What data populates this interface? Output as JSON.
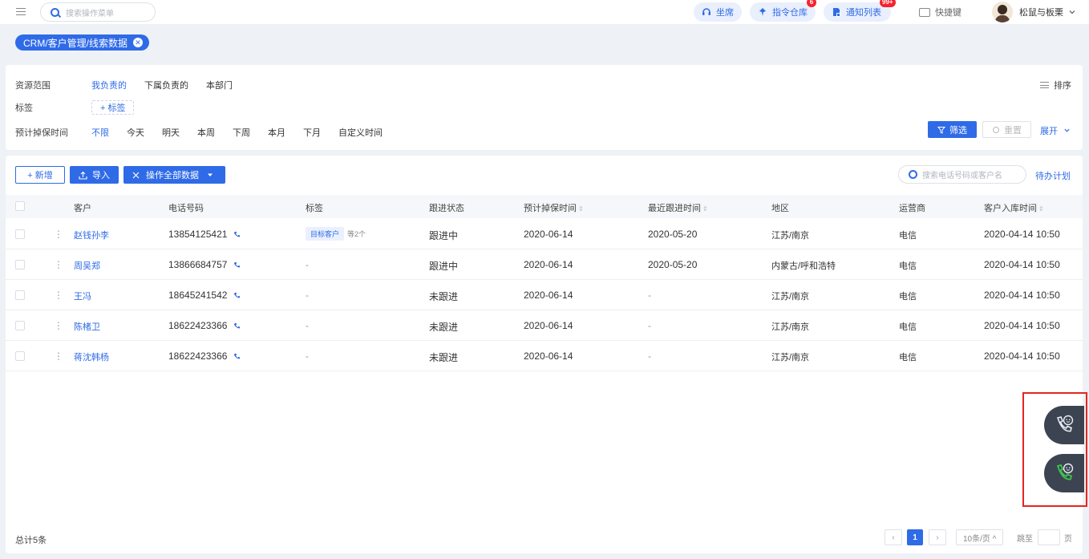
{
  "topbar": {
    "search_placeholder": "搜索操作菜单",
    "seat_label": "坐席",
    "command_label": "指令仓库",
    "command_badge": "6",
    "notify_label": "通知列表",
    "notify_badge": "99+",
    "shortcut_label": "快捷键",
    "user_name": "松鼠与板栗"
  },
  "breadcrumb": {
    "label": "CRM/客户管理/线索数据"
  },
  "filters": {
    "scope_label": "资源范围",
    "scope_options": [
      "我负责的",
      "下属负责的",
      "本部门"
    ],
    "tag_label": "标签",
    "tag_add": "+ 标签",
    "time_label": "预计掉保时间",
    "time_options": [
      "不限",
      "今天",
      "明天",
      "本周",
      "下周",
      "本月",
      "下月",
      "自定义时间"
    ],
    "sort_label": "排序",
    "filter_button": "筛选",
    "reset_button": "重置",
    "expand_label": "展开"
  },
  "toolbar": {
    "add_button": "+ 新增",
    "import_button": "导入",
    "ops_button": "操作全部数据",
    "search_placeholder": "搜索电话号码或客户名",
    "todo_link": "待办计划"
  },
  "table": {
    "headers": [
      "客户",
      "电话号码",
      "标签",
      "跟进状态",
      "预计掉保时间",
      "最近跟进时间",
      "地区",
      "运营商",
      "客户入库时间"
    ],
    "rows": [
      {
        "customer": "赵钱孙李",
        "phone": "13854125421",
        "tag": "目标客户",
        "tag_more": "等2个",
        "status": "跟进中",
        "expected": "2020-06-14",
        "last": "2020-05-20",
        "region": "江苏/南京",
        "carrier": "电信",
        "created": "2020-04-14  10:50"
      },
      {
        "customer": "周吴郑",
        "phone": "13866684757",
        "tag": "-",
        "tag_more": "",
        "status": "跟进中",
        "expected": "2020-06-14",
        "last": "2020-05-20",
        "region": "内蒙古/呼和浩特",
        "carrier": "电信",
        "created": "2020-04-14  10:50"
      },
      {
        "customer": "王冯",
        "phone": "18645241542",
        "tag": "-",
        "tag_more": "",
        "status": "未跟进",
        "expected": "2020-06-14",
        "last": "-",
        "region": "江苏/南京",
        "carrier": "电信",
        "created": "2020-04-14  10:50"
      },
      {
        "customer": "陈楮卫",
        "phone": "18622423366",
        "tag": "-",
        "tag_more": "",
        "status": "未跟进",
        "expected": "2020-06-14",
        "last": "-",
        "region": "江苏/南京",
        "carrier": "电信",
        "created": "2020-04-14  10:50"
      },
      {
        "customer": "蒋沈韩杨",
        "phone": "18622423366",
        "tag": "-",
        "tag_more": "",
        "status": "未跟进",
        "expected": "2020-06-14",
        "last": "-",
        "region": "江苏/南京",
        "carrier": "电信",
        "created": "2020-04-14  10:50"
      }
    ]
  },
  "footer": {
    "total": "总计5条",
    "current_page": "1",
    "page_size": "10条/页 ^",
    "jump_label": "跳至",
    "page_suffix": "页"
  },
  "colors": {
    "accent": "#2f6be7",
    "highlight_box": "#e3261f",
    "widget": "#3c4451"
  }
}
